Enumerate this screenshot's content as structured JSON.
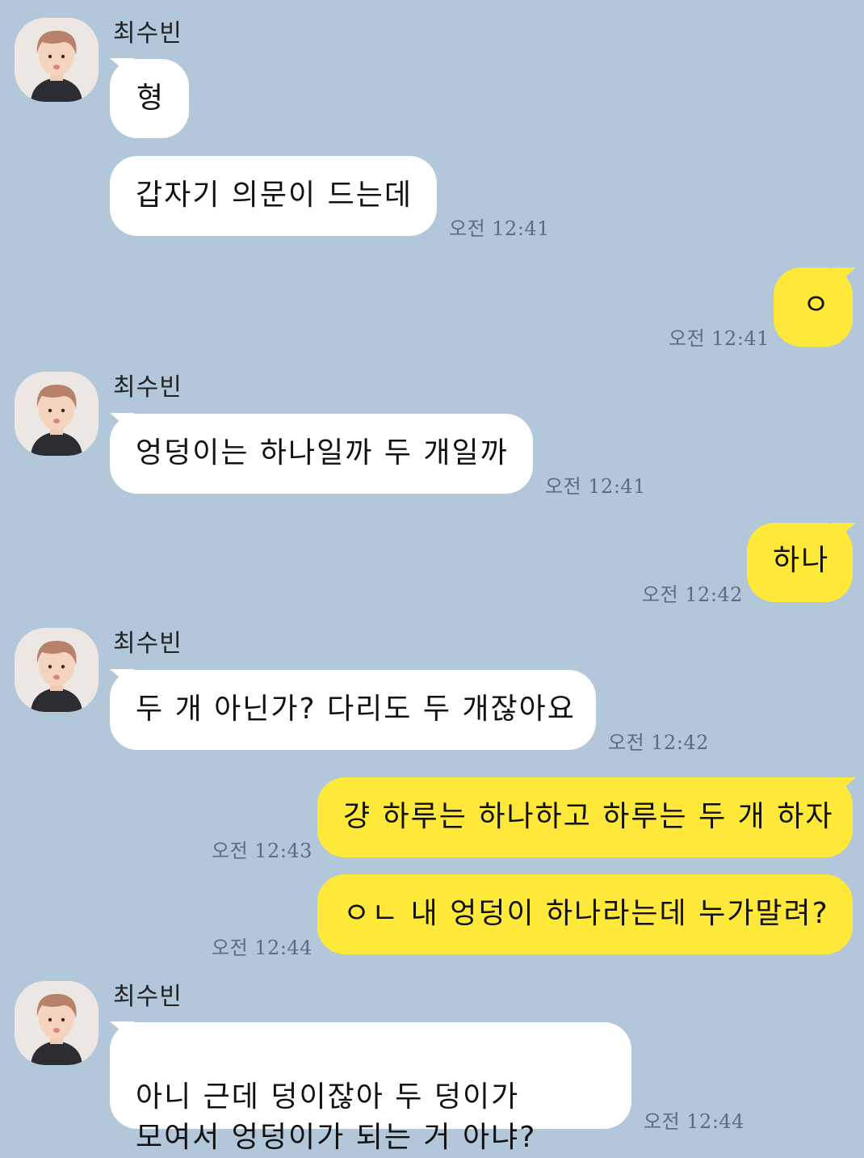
{
  "sender": {
    "name": "최수빈",
    "avatar": "profile-photo-icon"
  },
  "colors": {
    "background": "#b2c7d9",
    "incoming": "#ffffff",
    "outgoing": "#fee93b"
  },
  "messages": [
    {
      "text": "형"
    },
    {
      "text": "갑자기 의문이 드는데",
      "time": "오전 12:41"
    },
    {
      "text": "ㅇ",
      "time": "오전 12:41"
    },
    {
      "text": "엉덩이는 하나일까 두 개일까",
      "time": "오전 12:41"
    },
    {
      "text": "하나",
      "time": "오전 12:42"
    },
    {
      "text": "두 개 아닌가? 다리도 두 개잖아요",
      "time": "오전 12:42"
    },
    {
      "text": "걍 하루는 하나하고 하루는 두 개 하자",
      "time": "오전 12:43"
    },
    {
      "text": "ㅇㄴ 내 엉덩이 하나라는데 누가말려?",
      "time": "오전 12:44"
    },
    {
      "text": "아니 근데 덩이잖아 두 덩이가\n모여서 엉덩이가 되는 거 아냐?",
      "time": "오전 12:44"
    }
  ]
}
